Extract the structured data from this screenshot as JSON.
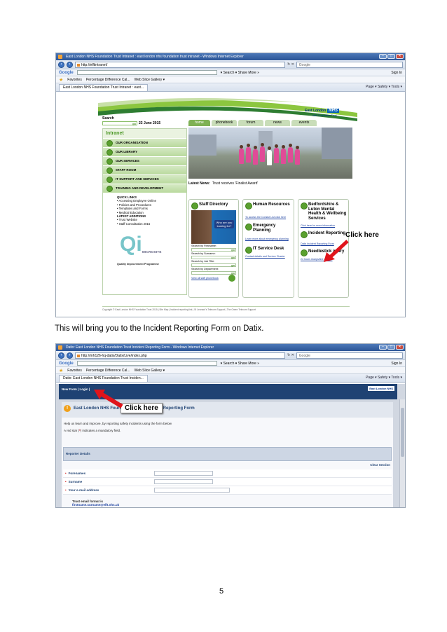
{
  "doc": {
    "instruction": "This will bring you to the Incident Reporting Form on Datix.",
    "page_number": "5"
  },
  "shot1": {
    "window_title": "East London NHS Foundation Trust Intranet : east london nhs foundation trust intranet - Windows Internet Explorer",
    "url": "http://elftintranet/",
    "search_engine": "Google",
    "google_logo": "Google",
    "google_toolbar": "▾ Search ▾  Share  More »",
    "sign_in": "Sign In",
    "favorites": "Favorites",
    "fav_item1": "Percentage Difference Cal...",
    "fav_item2": "Web Slice Gallery ▾",
    "tab_title": "East London NHS Foundation Trust Intranet : east...",
    "commands": "Page ▾  Safety ▾  Tools ▾",
    "brand": "East London",
    "nhs": "NHS",
    "brand_sub": "NHS Foundation Trust",
    "search_label": "Search",
    "go": "go",
    "date": "23 June 2015",
    "nav_tabs": [
      "home",
      "phonebook",
      "forum",
      "news",
      "events"
    ],
    "intranet_title": "Intranet",
    "menu": [
      "OUR ORGANISATION",
      "OUR LIBRARY",
      "OUR SERVICES",
      "STAFF ROOM",
      "IT SUPPORT AND SERVICES",
      "TRAINING AND DEVELOPMENT"
    ],
    "quick_links_title": "QUICK LINKS",
    "quick_links": [
      "• Accessing Employee Online",
      "• Policies and Procedures",
      "• Templates and Forms",
      "• Medical Education"
    ],
    "latest_title": "LATEST ADDITIONS",
    "latest_links": [
      "• Trust Website",
      "• Staff Consultation 2015"
    ],
    "qi_letters": "Qi",
    "qi_microsite": "MICROSITE",
    "qi_caption": "Quality Improvement Programme",
    "latest_news_label": "Latest News:",
    "latest_news_text": "Trust receives 'Finalist Award'",
    "staff_directory": "Staff Directory",
    "staff_tag": "Who are you looking for?",
    "search_firstname": "Search by Firstname:",
    "search_surname": "Search by Surname:",
    "search_jobtitle": "Search by Job Title:",
    "search_department": "Search by Department:",
    "view_all": "View all staff phonebook",
    "hr_title": "Human Resources",
    "hr_link": "To access the Contact List click here",
    "ep_title": "Emergency Planning",
    "ep_link": "Learn more about emergency planning",
    "it_title": "IT Service Desk",
    "it_link": "Contact details and Service Charter",
    "bl_title": "Bedfordshire & Luton Mental Health & Wellbeing Services",
    "bl_link": "Click here for more information",
    "ir_title": "Incident Reporting",
    "ir_link": "Datix Incident Reporting Form",
    "ni_title": "Needlestick injury",
    "ni_link": "24 hours sharps/line number",
    "footer": "Copyright © East London NHS Foundation Trust 2015   |   Site Map   |   Incident reporting link   |   St Leonard's Telecom Support   |   The Green Telecom Support",
    "callout": "Click here"
  },
  "shot2": {
    "window_title": "Datix: East London NHS Foundation Trust Incident Reporting Form - Windows Internet Explorer",
    "url": "http://mh126-hq-datix/Datix/Live/index.php",
    "search_engine": "Google",
    "google_logo": "Google",
    "google_toolbar": "▾ Search ▾  Share  More »",
    "sign_in": "Sign In",
    "favorites": "Favorites",
    "fav_item1": "Percentage Difference Cal...",
    "fav_item2": "Web Slice Gallery ▾",
    "tab_title": "Datix: East London NHS Foundation Trust Inciden...",
    "commands": "Page ▾  Safety ▾  Tools ▾",
    "menu": "New Form  |  Login  |",
    "org_logo": "East London NHS",
    "form_title": "East London NHS Foundation Trust Incident Reporting Form",
    "intro1": "Help us learn and improve, by reporting safety incidents using the form below",
    "intro2_a": "A red star (",
    "intro2_star": "*",
    "intro2_b": ") indicates a mandatory field.",
    "section": "Reporter Details",
    "clear_section": "Clear Section",
    "fields": [
      "Forenames",
      "Surname",
      "Your e-mail address"
    ],
    "trust_email_label": "Trust email format is",
    "trust_email_example": "firstname.surname@elft.nhs.uk",
    "callout": "Click here"
  },
  "colors": {
    "ie_title": "#2c5596",
    "nhs_blue": "#005eb8",
    "intranet_green": "#5aa02f",
    "datix_navy": "#1f4273",
    "arrow_red": "#e0141b"
  }
}
